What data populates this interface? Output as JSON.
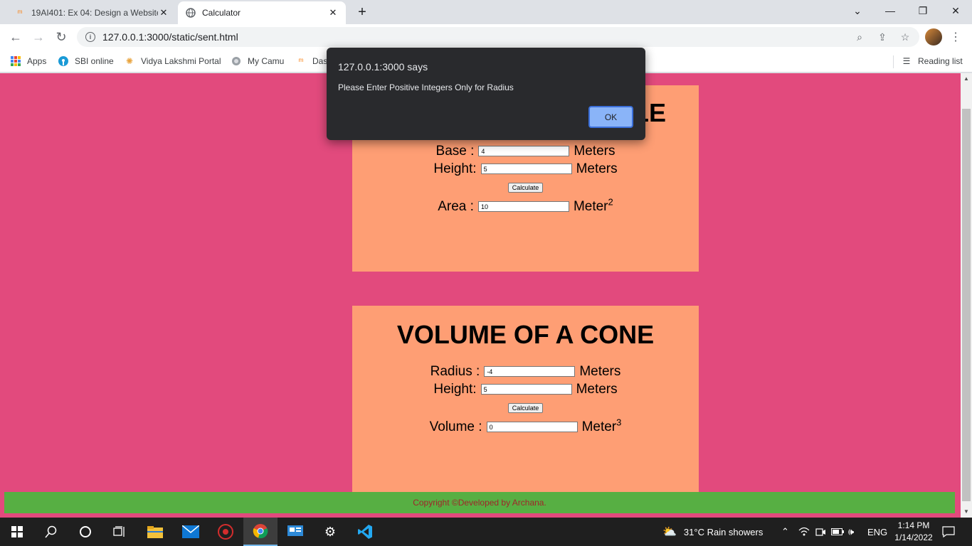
{
  "browser": {
    "tabs": [
      {
        "label": "19AI401: Ex 04: Design a Website",
        "active": false
      },
      {
        "label": "Calculator",
        "active": true
      }
    ],
    "url": "127.0.0.1:3000/static/sent.html",
    "bookmarks": [
      "Apps",
      "SBI online",
      "Vidya Lakshmi Portal",
      "My Camu",
      "Das"
    ],
    "reading_list": "Reading list"
  },
  "page": {
    "card1": {
      "title_fragment": "LE",
      "base_label": "Base :",
      "base_value": "4",
      "base_unit": "Meters",
      "height_label": "Height:",
      "height_value": "5",
      "height_unit": "Meters",
      "calc_label": "Calculate",
      "area_label": "Area :",
      "area_value": "10",
      "area_unit": "Meter",
      "area_exp": "2"
    },
    "card2": {
      "title": "VOLUME OF A CONE",
      "radius_label": "Radius :",
      "radius_value": "-4",
      "radius_unit": "Meters",
      "height_label": "Height:",
      "height_value": "5",
      "height_unit": "Meters",
      "calc_label": "Calculate",
      "volume_label": "Volume :",
      "volume_value": "0",
      "volume_unit": "Meter",
      "volume_exp": "3"
    },
    "footer": "Copyright ©Developed by Archana."
  },
  "dialog": {
    "title": "127.0.0.1:3000 says",
    "message": "Please Enter Positive Integers Only for Radius",
    "ok_label": "OK"
  },
  "taskbar": {
    "weather": "31°C  Rain showers",
    "lang": "ENG",
    "time": "1:14 PM",
    "date": "1/14/2022"
  },
  "colors": {
    "page_bg": "#e24a7d",
    "card_bg": "#fe9e74",
    "footer_bg": "#57af43",
    "footer_text": "#a0252a",
    "dialog_bg": "#292a2d",
    "ok_bg": "#8ab4f8"
  }
}
